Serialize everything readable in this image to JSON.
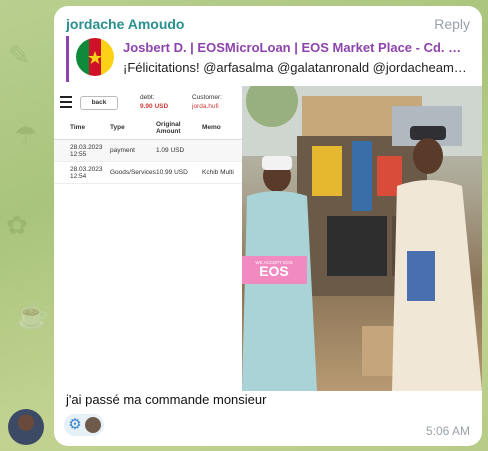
{
  "message": {
    "sender": "jordache Amoudo",
    "reply_label": "Reply",
    "caption": "j'ai passé ma commande monsieur",
    "time": "5:06 AM"
  },
  "quote": {
    "title": "Josbert D. | EOSMicroLoan | EOS Market Place - Cd. Gu...",
    "text": "¡Félicitations! @arfasalma @galatanronald @jordacheamoudo",
    "avatar_icon": "cameroon-flag-icon"
  },
  "receipt": {
    "back_label": "back",
    "debt_label": "debt:",
    "debt_value": "9.90 USD",
    "customer_label": "Customer:",
    "customer_value": "jorda.hufi",
    "columns": [
      "Time",
      "Type",
      "Original Amount",
      "Memo"
    ],
    "rows": [
      [
        "28.03.2023 12:55",
        "payment",
        "1.09 USD",
        ""
      ],
      [
        "28.03.2023 12:54",
        "Goods/Services",
        "10.99 USD",
        "Kchib Multi"
      ]
    ]
  },
  "photo": {
    "sign_text": "EOS",
    "sign_subtext": "WE ACCEPT EOS"
  },
  "reactions": {
    "icons": [
      "gear-icon",
      "user-avatar-icon"
    ]
  },
  "colors": {
    "sender": "#2a8f8f",
    "quote_accent": "#8e44ad",
    "debt": "#d23a3a"
  }
}
